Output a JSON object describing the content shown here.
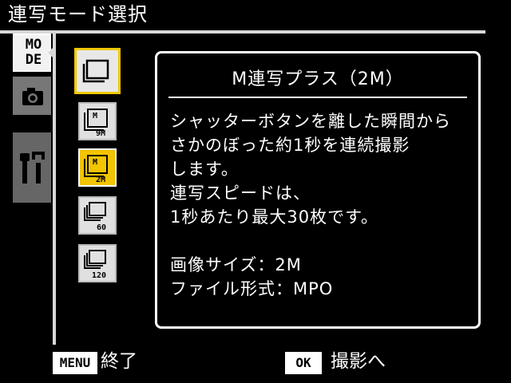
{
  "header": {
    "title": "連写モード選択"
  },
  "tabs": {
    "mode_label_line1": "MO",
    "mode_label_line2": "DE"
  },
  "options": [
    {
      "id": "continuous"
    },
    {
      "id": "m-9m",
      "label_top": "M",
      "label_bottom": "9M"
    },
    {
      "id": "m-2m",
      "label_top": "M",
      "label_bottom": "2M"
    },
    {
      "id": "60",
      "label": "60"
    },
    {
      "id": "120",
      "label": "120"
    }
  ],
  "panel": {
    "title": "M連写プラス（2M）",
    "lines": [
      "シャッターボタンを離した瞬間から",
      "さかのぼった約1秒を連続撮影",
      "します。",
      "連写スピードは、",
      "1秒あたり最大30枚です。"
    ],
    "image_size": "画像サイズ：2M",
    "file_format": "ファイル形式：MPO"
  },
  "footer": {
    "menu_key": "MENU",
    "menu_label": "終了",
    "ok_key": "OK",
    "ok_label": "撮影へ"
  },
  "colors": {
    "selected": "#f3c400",
    "background": "#000000",
    "frame": "#d8d8d8"
  }
}
